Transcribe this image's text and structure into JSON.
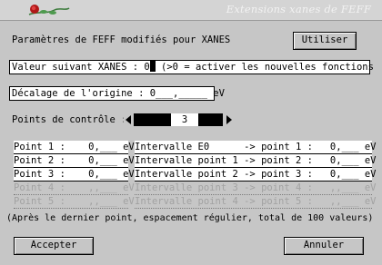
{
  "window": {
    "title": "Extensions xanes de FEFF"
  },
  "header": {
    "label": "Paramètres de FEFF modifiés pour XANES",
    "use_button": "Utiliser"
  },
  "xanes_field": {
    "prefix": "Valeur suivant XANES : 0",
    "suffix": " (>0 = activer les nouvelles fonctions"
  },
  "origin_field": {
    "value": "Décalage de l'origine : 0___,_____ eV"
  },
  "control_points": {
    "label": "Points de contrôle :",
    "value": "3"
  },
  "points": [
    {
      "point": "Point 1 :    0,___ eV",
      "interval": "Intervalle E0      -> point 1 :   0,___ eV",
      "enabled": true
    },
    {
      "point": "Point 2 :    0,___ eV",
      "interval": "Intervalle point 1 -> point 2 :   0,___ eV",
      "enabled": true
    },
    {
      "point": "Point 3 :    0,___ eV",
      "interval": "Intervalle point 2 -> point 3 :   0,___ eV",
      "enabled": true
    },
    {
      "point": "Point 4 :    ,,___ eV",
      "interval": "Intervalle point 3 -> point 4 :   ,,___ eV",
      "enabled": false
    },
    {
      "point": "Point 5 :    ,,___ eV",
      "interval": "Intervalle point 4 -> point 5 :   ,,___ eV",
      "enabled": false
    }
  ],
  "footnote": "(Après le dernier point, espacement régulier, total de 100 valeurs)",
  "buttons": {
    "accept": "Accepter",
    "cancel": "Annuler"
  }
}
